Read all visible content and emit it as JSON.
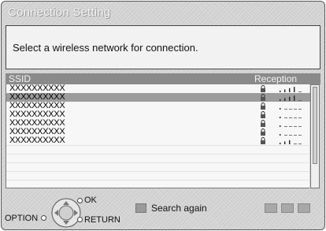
{
  "header": {
    "title": "Connection Setting"
  },
  "message": "Select a wireless network for connection.",
  "list": {
    "columns": {
      "ssid": "SSID",
      "reception": "Reception"
    },
    "networks": [
      {
        "ssid": "XXXXXXXXXX",
        "locked": true,
        "signal_bars": 4,
        "selected": false
      },
      {
        "ssid": "XXXXXXXXXX",
        "locked": true,
        "signal_bars": 4,
        "selected": true
      },
      {
        "ssid": "XXXXXXXXXX",
        "locked": true,
        "signal_bars": 1,
        "selected": false
      },
      {
        "ssid": "XXXXXXXXXX",
        "locked": true,
        "signal_bars": 1,
        "selected": false
      },
      {
        "ssid": "XXXXXXXXXX",
        "locked": true,
        "signal_bars": 1,
        "selected": false
      },
      {
        "ssid": "XXXXXXXXXX",
        "locked": true,
        "signal_bars": 1,
        "selected": false
      },
      {
        "ssid": "XXXXXXXXXX",
        "locked": true,
        "signal_bars": 3,
        "selected": false
      }
    ]
  },
  "footer": {
    "ok_label": "OK",
    "option_label": "OPTION",
    "return_label": "RETURN",
    "search_label": "Search again"
  }
}
